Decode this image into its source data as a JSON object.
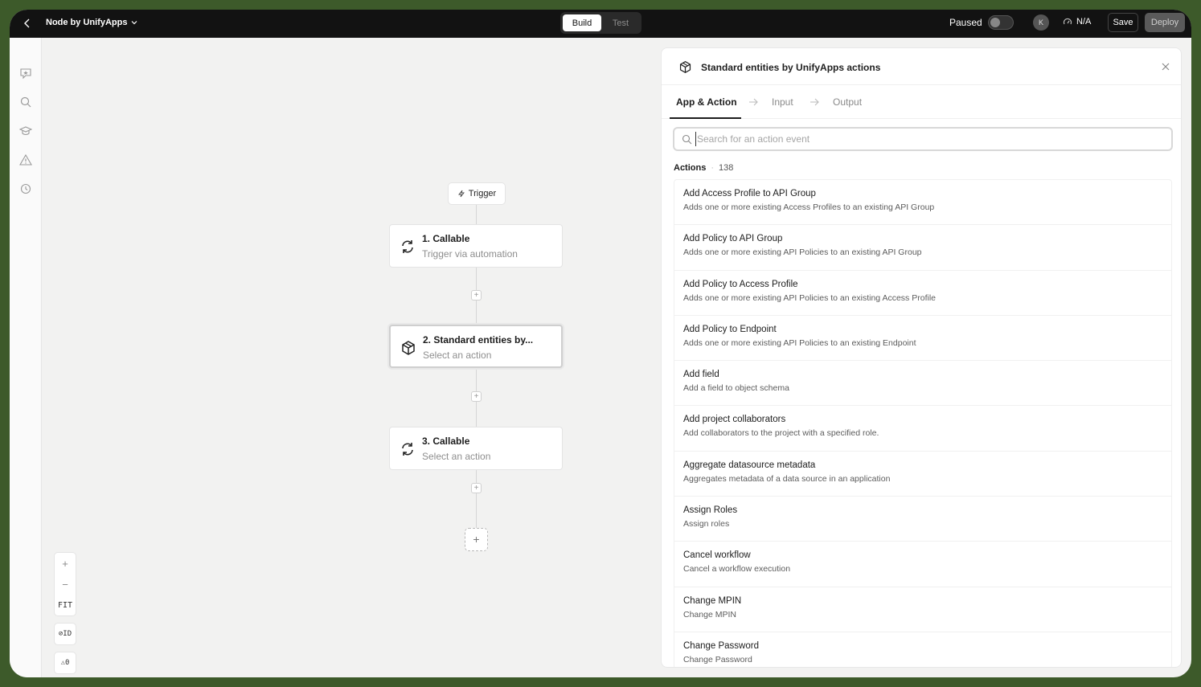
{
  "topbar": {
    "app_name": "Node by UnifyApps",
    "mode_build": "Build",
    "mode_test": "Test",
    "status": "Paused",
    "avatar_initial": "K",
    "metric": "N/A",
    "save_label": "Save",
    "deploy_label": "Deploy"
  },
  "canvas": {
    "trigger_label": "Trigger",
    "nodes": [
      {
        "title": "1. Callable",
        "subtitle": "Trigger via automation"
      },
      {
        "title": "2. Standard entities by...",
        "subtitle": "Select an action"
      },
      {
        "title": "3. Callable",
        "subtitle": "Select an action"
      }
    ],
    "zoom_fit": "FIT",
    "id_toggle": "⊘ID",
    "warnings": "⚠0"
  },
  "panel": {
    "title": "Standard entities by UnifyApps actions",
    "tabs": [
      "App & Action",
      "Input",
      "Output"
    ],
    "search_placeholder": "Search for an action event",
    "actions_label": "Actions",
    "actions_count": "138",
    "items": [
      {
        "title": "Add Access Profile to API Group",
        "desc": "Adds one or more existing Access Profiles to an existing API Group"
      },
      {
        "title": "Add Policy to API Group",
        "desc": "Adds one or more existing API Policies to an existing API Group"
      },
      {
        "title": "Add Policy to Access Profile",
        "desc": "Adds one or more existing API Policies to an existing Access Profile"
      },
      {
        "title": "Add Policy to Endpoint",
        "desc": "Adds one or more existing API Policies to an existing Endpoint"
      },
      {
        "title": "Add field",
        "desc": "Add a field to object schema"
      },
      {
        "title": "Add project collaborators",
        "desc": "Add collaborators to the project with a specified role."
      },
      {
        "title": "Aggregate datasource metadata",
        "desc": "Aggregates metadata of a data source in an application"
      },
      {
        "title": "Assign Roles",
        "desc": "Assign roles"
      },
      {
        "title": "Cancel workflow",
        "desc": "Cancel a workflow execution"
      },
      {
        "title": "Change MPIN",
        "desc": "Change MPIN"
      },
      {
        "title": "Change Password",
        "desc": "Change Password"
      }
    ]
  }
}
